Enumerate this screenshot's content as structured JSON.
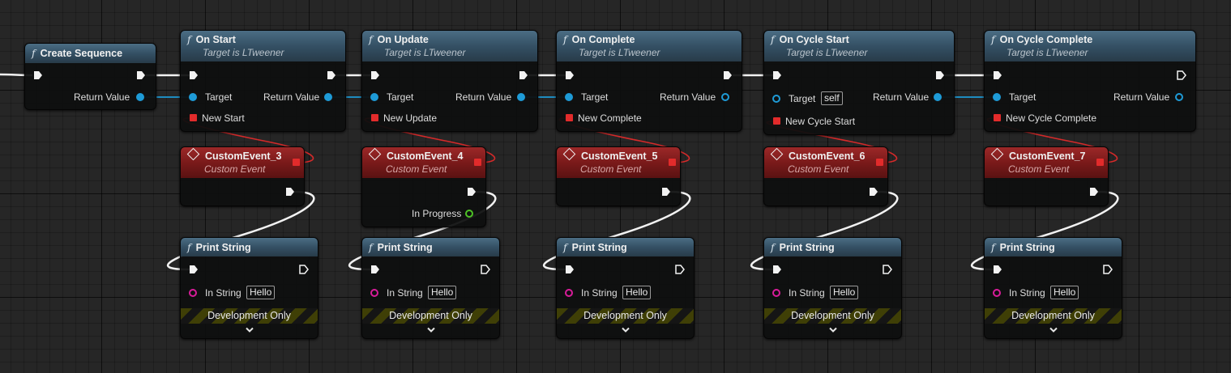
{
  "nodes": {
    "create_sequence": {
      "title": "Create Sequence",
      "return_label": "Return Value"
    },
    "on_start": {
      "title": "On Start",
      "subtitle": "Target is LTweener",
      "target_label": "Target",
      "return_label": "Return Value",
      "event_label": "New Start"
    },
    "on_update": {
      "title": "On Update",
      "subtitle": "Target is LTweener",
      "target_label": "Target",
      "return_label": "Return Value",
      "event_label": "New Update"
    },
    "on_complete": {
      "title": "On Complete",
      "subtitle": "Target is LTweener",
      "target_label": "Target",
      "return_label": "Return Value",
      "event_label": "New Complete"
    },
    "on_cycle_start": {
      "title": "On Cycle Start",
      "subtitle": "Target is LTweener",
      "target_label": "Target",
      "target_value": "self",
      "return_label": "Return Value",
      "event_label": "New Cycle Start"
    },
    "on_cycle_complete": {
      "title": "On Cycle Complete",
      "subtitle": "Target is LTweener",
      "target_label": "Target",
      "return_label": "Return Value",
      "event_label": "New Cycle Complete"
    }
  },
  "events": [
    {
      "title": "CustomEvent_3",
      "subtitle": "Custom Event"
    },
    {
      "title": "CustomEvent_4",
      "subtitle": "Custom Event",
      "param_label": "In Progress"
    },
    {
      "title": "CustomEvent_5",
      "subtitle": "Custom Event"
    },
    {
      "title": "CustomEvent_6",
      "subtitle": "Custom Event"
    },
    {
      "title": "CustomEvent_7",
      "subtitle": "Custom Event"
    }
  ],
  "prints": [
    {
      "title": "Print String",
      "in_label": "In String",
      "in_value": "Hello",
      "dev_label": "Development Only"
    },
    {
      "title": "Print String",
      "in_label": "In String",
      "in_value": "Hello",
      "dev_label": "Development Only"
    },
    {
      "title": "Print String",
      "in_label": "In String",
      "in_value": "Hello",
      "dev_label": "Development Only"
    },
    {
      "title": "Print String",
      "in_label": "In String",
      "in_value": "Hello",
      "dev_label": "Development Only"
    },
    {
      "title": "Print String",
      "in_label": "In String",
      "in_value": "Hello",
      "dev_label": "Development Only"
    }
  ],
  "icons": {
    "function": "function-icon",
    "event": "event-diamond-icon",
    "exec": "exec-pin-icon",
    "chevron": "chevron-down-icon"
  },
  "colors": {
    "object_pin": "#1e9bd7",
    "string_pin": "#d91c9a",
    "bool_pin": "#4ec326",
    "delegate_pin": "#e22b2b",
    "func_header": "#345064",
    "event_header": "#7a1a1a"
  }
}
